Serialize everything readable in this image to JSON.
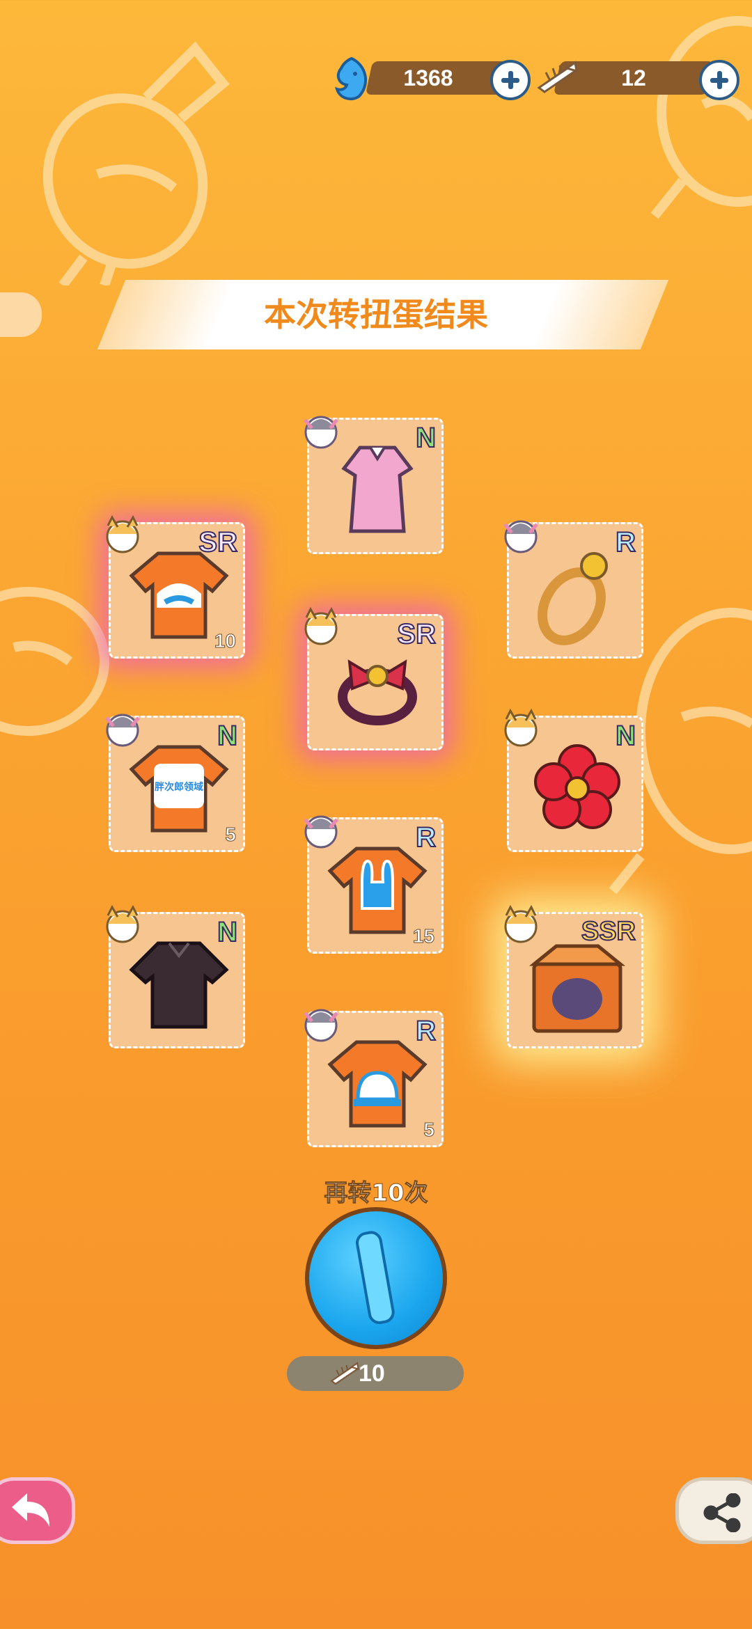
{
  "currency": {
    "gems_value": "1368",
    "tickets_value": "12"
  },
  "banner": {
    "title": "本次转扭蛋结果"
  },
  "results": [
    {
      "rarity": "N",
      "count": "",
      "item": "pink-dress-icon"
    },
    {
      "rarity": "SR",
      "count": "10",
      "item": "orange-shirt-icon"
    },
    {
      "rarity": "R",
      "count": "",
      "item": "ring-icon"
    },
    {
      "rarity": "SR",
      "count": "",
      "item": "bow-bracelet-icon"
    },
    {
      "rarity": "N",
      "count": "5",
      "item": "orange-shirt-icon"
    },
    {
      "rarity": "N",
      "count": "",
      "item": "red-flower-icon"
    },
    {
      "rarity": "R",
      "count": "15",
      "item": "orange-shirt-icon"
    },
    {
      "rarity": "N",
      "count": "",
      "item": "black-shirt-icon"
    },
    {
      "rarity": "SSR",
      "count": "",
      "item": "cat-box-icon"
    },
    {
      "rarity": "R",
      "count": "5",
      "item": "orange-shirt-icon"
    }
  ],
  "shirt_print_text": "胖次郎领域",
  "spin": {
    "label": "再转10次",
    "cost": "10"
  },
  "colors": {
    "accent": "#fba733",
    "button": "#1aa6ee",
    "text_orange": "#f08a1c"
  }
}
